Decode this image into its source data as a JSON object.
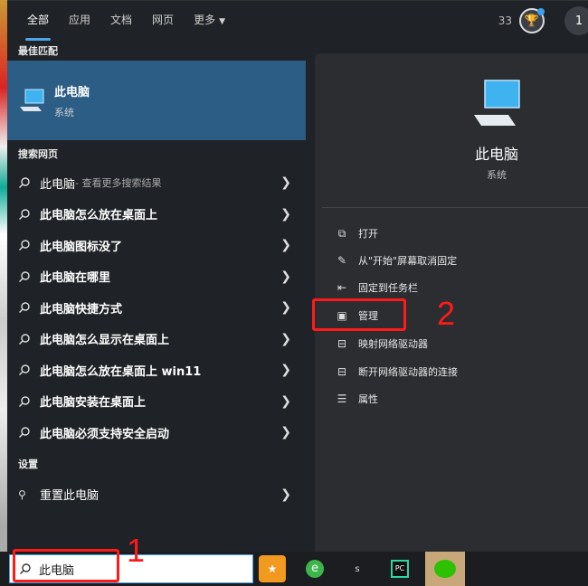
{
  "tabs": [
    {
      "label": "全部",
      "active": true
    },
    {
      "label": "应用",
      "active": false
    },
    {
      "label": "文档",
      "active": false
    },
    {
      "label": "网页",
      "active": false
    },
    {
      "label": "更多",
      "active": false
    }
  ],
  "header": {
    "points": "33",
    "user_initial": "1"
  },
  "best_match": {
    "heading": "最佳匹配",
    "title": "此电脑",
    "subtitle": "系统"
  },
  "web": {
    "heading": "搜索网页",
    "items": [
      {
        "text": "此电脑",
        "hint": " - 查看更多搜索结果"
      },
      {
        "text": "此电脑怎么放在桌面上"
      },
      {
        "text": "此电脑图标没了"
      },
      {
        "text": "此电脑在哪里"
      },
      {
        "text": "此电脑快捷方式"
      },
      {
        "text": "此电脑怎么显示在桌面上"
      },
      {
        "text": "此电脑怎么放在桌面上 win11"
      },
      {
        "text": "此电脑安装在桌面上"
      },
      {
        "text": "此电脑必须支持安全启动"
      }
    ]
  },
  "settings": {
    "heading": "设置",
    "items": [
      {
        "text": "重置此电脑"
      }
    ]
  },
  "detail": {
    "title": "此电脑",
    "subtitle": "系统",
    "actions": [
      {
        "label": "打开",
        "icon": "open-icon"
      },
      {
        "label": "从\"开始\"屏幕取消固定",
        "icon": "unpin-icon"
      },
      {
        "label": "固定到任务栏",
        "icon": "pin-taskbar-icon"
      },
      {
        "label": "管理",
        "icon": "manage-icon"
      },
      {
        "label": "映射网络驱动器",
        "icon": "map-drive-icon"
      },
      {
        "label": "断开网络驱动器的连接",
        "icon": "disconnect-drive-icon"
      },
      {
        "label": "属性",
        "icon": "properties-icon"
      }
    ]
  },
  "annotations": {
    "one": "1",
    "two": "2"
  },
  "taskbar": {
    "search_value": "此电脑",
    "apps": [
      "s"
    ]
  },
  "colors": {
    "accent": "#4aa6e8",
    "highlight": "#2b5d85",
    "annotation": "#ff1a1a"
  }
}
